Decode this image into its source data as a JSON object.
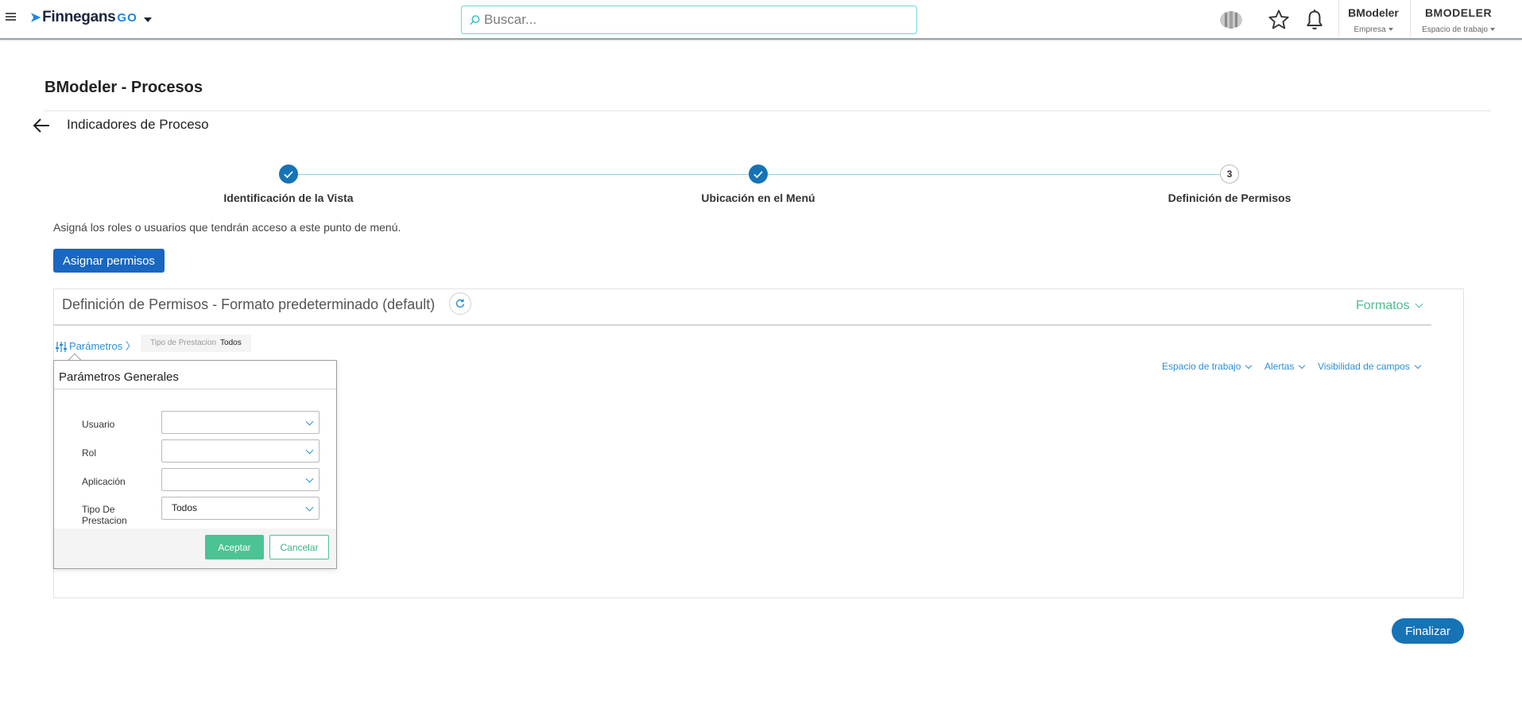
{
  "topbar": {
    "logo_main": "Finnegans",
    "logo_go": "GO",
    "search_placeholder": "Buscar...",
    "company_name": "BModeler",
    "company_label": "Empresa",
    "workspace_name": "BMODELER",
    "workspace_label": "Espacio de trabajo"
  },
  "page": {
    "title": "BModeler - Procesos",
    "subtitle": "Indicadores de Proceso"
  },
  "stepper": {
    "steps": [
      {
        "label": "Identificación de la Vista",
        "status": "done"
      },
      {
        "label": "Ubicación en el Menú",
        "status": "done"
      },
      {
        "label": "Definición de Permisos",
        "status": "current",
        "number": "3"
      }
    ]
  },
  "content": {
    "description": "Asigná los roles o usuarios que tendrán acceso a este punto de menú.",
    "assign_button": "Asignar permisos",
    "finish_button": "Finalizar"
  },
  "panel": {
    "title": "Definición de Permisos - Formato predeterminado (default)",
    "formats_label": "Formatos",
    "params_link": "Parámetros",
    "filter_chip": {
      "key": "Tipo de Prestacion",
      "value": "Todos"
    },
    "right_links": [
      "Espacio de trabajo",
      "Alertas",
      "Visibilidad de campos"
    ]
  },
  "params_popup": {
    "title": "Parámetros Generales",
    "fields": [
      {
        "label": "Usuario",
        "value": ""
      },
      {
        "label": "Rol",
        "value": ""
      },
      {
        "label": "Aplicación",
        "value": ""
      },
      {
        "label": "Tipo De Prestacion",
        "value": "Todos"
      }
    ],
    "accept": "Aceptar",
    "cancel": "Cancelar"
  },
  "colors": {
    "primary_blue": "#1673b6",
    "assign_blue": "#1967c0",
    "green_accent": "#4cc393",
    "link_blue": "#2d8fd5"
  }
}
